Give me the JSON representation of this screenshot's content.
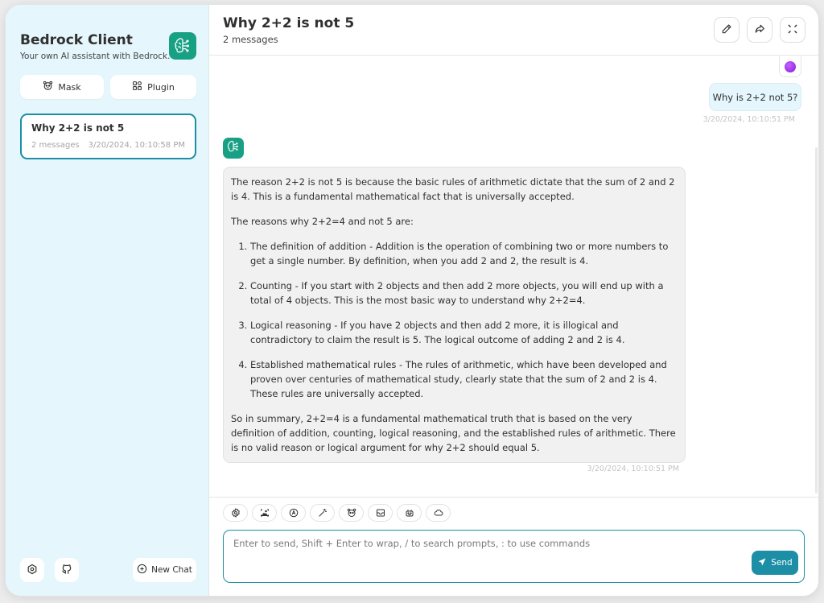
{
  "sidebar": {
    "title": "Bedrock Client",
    "subtitle": "Your own AI assistant with Bedrock.",
    "logo_icon": "brain-circuit-icon",
    "buttons": {
      "mask": {
        "label": "Mask",
        "icon": "mask-icon"
      },
      "plugin": {
        "label": "Plugin",
        "icon": "grid-icon"
      }
    },
    "chats": [
      {
        "title": "Why 2+2 is not 5",
        "count": "2 messages",
        "timestamp": "3/20/2024, 10:10:58 PM",
        "selected": true
      }
    ],
    "bottom": {
      "settings_icon": "settings-icon",
      "github_icon": "github-icon",
      "new_chat_label": "New Chat",
      "new_chat_icon": "plus-circle-icon"
    }
  },
  "header": {
    "title": "Why 2+2 is not 5",
    "subtitle": "2 messages",
    "actions": [
      "edit-icon",
      "share-icon",
      "fullscreen-icon"
    ]
  },
  "messages": [
    {
      "role": "user",
      "text": "Why is 2+2 not 5?",
      "timestamp": "3/20/2024, 10:10:51 PM"
    },
    {
      "role": "assistant",
      "intro": "The reason 2+2 is not 5 is because the basic rules of arithmetic dictate that the sum of 2 and 2 is 4. This is a fundamental mathematical fact that is universally accepted.",
      "lead": "The reasons why 2+2=4 and not 5 are:",
      "list": [
        "The definition of addition - Addition is the operation of combining two or more numbers to get a single number. By definition, when you add 2 and 2, the result is 4.",
        "Counting - If you start with 2 objects and then add 2 more objects, you will end up with a total of 4 objects. This is the most basic way to understand why 2+2=4.",
        "Logical reasoning - If you have 2 objects and then add 2 more, it is illogical and contradictory to claim the result is 5. The logical outcome of adding 2 and 2 is 4.",
        "Established mathematical rules - The rules of arithmetic, which have been developed and proven over centuries of mathematical study, clearly state that the sum of 2 and 2 is 4. These rules are universally accepted."
      ],
      "summary": "So in summary, 2+2=4 is a fundamental mathematical truth that is based on the very definition of addition, counting, logical reasoning, and the established rules of arithmetic. There is no valid reason or logical argument for why 2+2 should equal 5.",
      "timestamp": "3/20/2024, 10:10:51 PM"
    }
  ],
  "toolbar": [
    "settings-icon",
    "image-upload-icon",
    "model-switch-icon",
    "magic-wand-icon",
    "mask-icon",
    "template-icon",
    "robot-icon",
    "cloud-icon"
  ],
  "input": {
    "placeholder": "Enter to send, Shift + Enter to wrap, / to search prompts, : to use commands",
    "value": "",
    "send_label": "Send"
  },
  "colors": {
    "accent": "#1c8ea5",
    "logo": "#18a085",
    "sidebar_bg": "#e5f6fd",
    "user_bubble": "#e5f6fd",
    "bot_bubble": "#f1f1f1"
  }
}
